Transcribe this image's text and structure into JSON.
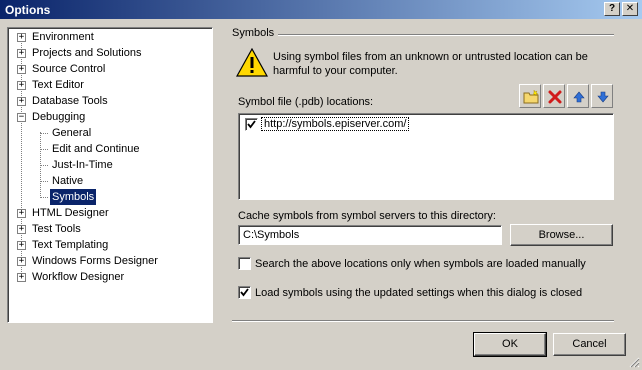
{
  "window": {
    "title": "Options"
  },
  "titlebar": {
    "help_glyph": "?",
    "close_glyph": "✕"
  },
  "tree": {
    "items": [
      {
        "label": "Environment",
        "expander": "+"
      },
      {
        "label": "Projects and Solutions",
        "expander": "+"
      },
      {
        "label": "Source Control",
        "expander": "+"
      },
      {
        "label": "Text Editor",
        "expander": "+"
      },
      {
        "label": "Database Tools",
        "expander": "+"
      },
      {
        "label": "Debugging",
        "expander": "−"
      },
      {
        "label": "General"
      },
      {
        "label": "Edit and Continue"
      },
      {
        "label": "Just-In-Time"
      },
      {
        "label": "Native"
      },
      {
        "label": "Symbols",
        "selected": true
      },
      {
        "label": "HTML Designer",
        "expander": "+"
      },
      {
        "label": "Test Tools",
        "expander": "+"
      },
      {
        "label": "Text Templating",
        "expander": "+"
      },
      {
        "label": "Windows Forms Designer",
        "expander": "+"
      },
      {
        "label": "Workflow Designer",
        "expander": "+"
      }
    ]
  },
  "symbols": {
    "group_label": "Symbols",
    "warning_text": "Using symbol files from an unknown or untrusted location can be harmful to your computer.",
    "locations_label": "Symbol file (.pdb) locations:",
    "locations": [
      {
        "url": "http://symbols.episerver.com/",
        "checked": true
      }
    ],
    "toolbar": {
      "icons": [
        "new-folder-icon",
        "delete-icon",
        "move-up-icon",
        "move-down-icon"
      ]
    },
    "cache_label": "Cache symbols from symbol servers to this directory:",
    "cache_value": "C:\\Symbols",
    "browse_label": "Browse...",
    "option_manual_label": "Search the above locations only when symbols are loaded manually",
    "option_manual_checked": false,
    "option_reload_label": "Load symbols using the updated settings when this dialog is closed",
    "option_reload_checked": true
  },
  "footer": {
    "ok_label": "OK",
    "cancel_label": "Cancel"
  },
  "colors": {
    "titlebar_start": "#0a246a",
    "titlebar_end": "#a6caf0",
    "selection": "#0a246a",
    "face": "#d4d0c8"
  }
}
